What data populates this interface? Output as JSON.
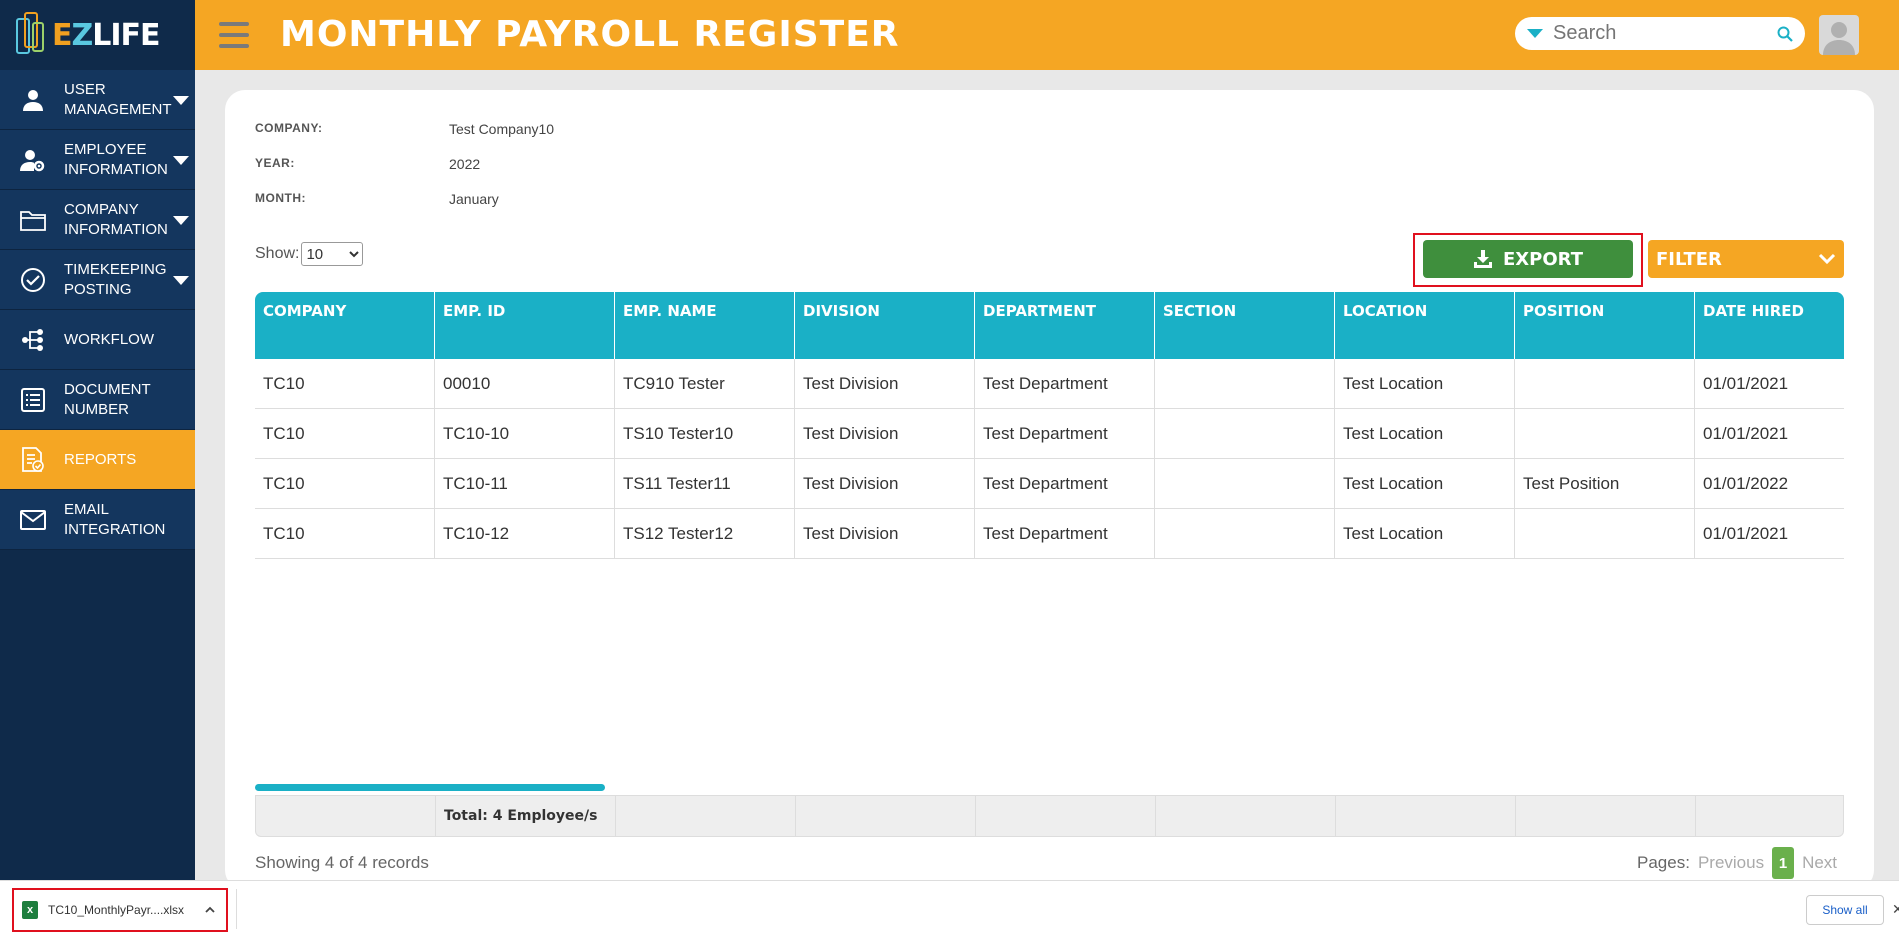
{
  "app": {
    "logo_text_e": "E",
    "logo_text_z": "Z",
    "logo_text_rest": "LIFE"
  },
  "sidebar": {
    "items": [
      {
        "label": "USER MANAGEMENT",
        "icon": "user-icon",
        "has_submenu": true
      },
      {
        "label": "EMPLOYEE INFORMATION",
        "icon": "user-gear-icon",
        "has_submenu": true
      },
      {
        "label": "COMPANY INFORMATION",
        "icon": "folder-icon",
        "has_submenu": true
      },
      {
        "label": "TIMEKEEPING POSTING",
        "icon": "check-circle-icon",
        "has_submenu": true
      },
      {
        "label": "WORKFLOW",
        "icon": "workflow-icon",
        "has_submenu": false
      },
      {
        "label": "DOCUMENT NUMBER",
        "icon": "list-icon",
        "has_submenu": false
      },
      {
        "label": "REPORTS",
        "icon": "report-icon",
        "has_submenu": false,
        "active": true
      },
      {
        "label": "EMAIL INTEGRATION",
        "icon": "mail-icon",
        "has_submenu": false
      }
    ]
  },
  "header": {
    "title": "MONTHLY PAYROLL REGISTER",
    "search_placeholder": "Search"
  },
  "report": {
    "company_label": "COMPANY:",
    "company_value": "Test Company10",
    "year_label": "YEAR:",
    "year_value": "2022",
    "month_label": "MONTH:",
    "month_value": "January"
  },
  "controls": {
    "show_label": "Show:",
    "show_value": "10",
    "export_label": "EXPORT",
    "filter_label": "FILTER"
  },
  "table": {
    "columns": [
      "COMPANY",
      "EMP. ID",
      "EMP. NAME",
      "DIVISION",
      "DEPARTMENT",
      "SECTION",
      "LOCATION",
      "POSITION",
      "DATE HIRED"
    ],
    "rows": [
      [
        "TC10",
        "00010",
        "TC910 Tester",
        "Test Division",
        "Test Department",
        "",
        "Test Location",
        "",
        "01/01/2021"
      ],
      [
        "TC10",
        "TC10-10",
        "TS10 Tester10",
        "Test Division",
        "Test Department",
        "",
        "Test Location",
        "",
        "01/01/2021"
      ],
      [
        "TC10",
        "TC10-11",
        "TS11 Tester11",
        "Test Division",
        "Test Department",
        "",
        "Test Location",
        "Test Position",
        "01/01/2022"
      ],
      [
        "TC10",
        "TC10-12",
        "TS12 Tester12",
        "Test Division",
        "Test Department",
        "",
        "Test Location",
        "",
        "01/01/2021"
      ]
    ],
    "footer_total": "Total: 4 Employee/s"
  },
  "pagination": {
    "showing_text": "Showing 4 of 4 records",
    "pages_label": "Pages:",
    "previous": "Previous",
    "current_page": "1",
    "next": "Next"
  },
  "download_bar": {
    "file_name": "TC10_MonthlyPayr....xlsx",
    "show_all": "Show all",
    "close": "✕"
  },
  "colors": {
    "brand_orange": "#f5a623",
    "sidebar_navy": "#0f2a4a",
    "table_header_teal": "#1ab0c6",
    "export_green": "#3f8f3d",
    "highlight_red": "#e0101e"
  }
}
